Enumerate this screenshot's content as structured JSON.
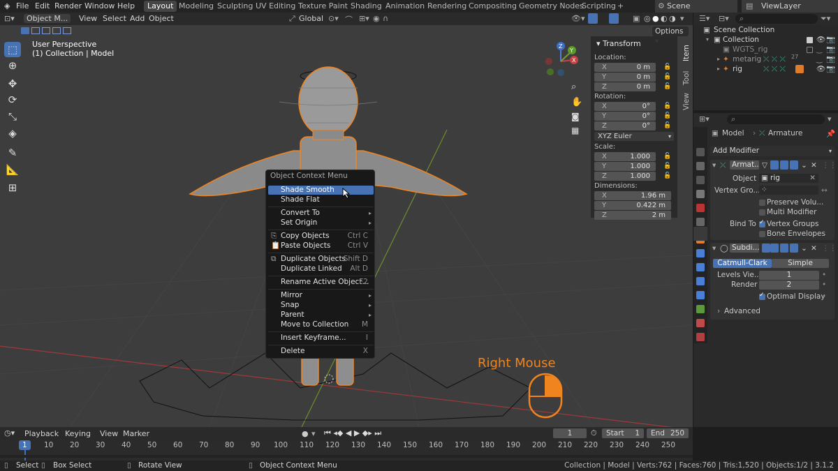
{
  "menubar": {
    "items": [
      "File",
      "Edit",
      "Render",
      "Window",
      "Help"
    ],
    "workspaces": [
      "Layout",
      "Modeling",
      "Sculpting",
      "UV Editing",
      "Texture Paint",
      "Shading",
      "Animation",
      "Rendering",
      "Compositing",
      "Geometry Nodes",
      "Scripting"
    ],
    "active_workspace": "Layout",
    "add_tab": "+",
    "scene": "Scene",
    "view_layer": "ViewLayer"
  },
  "viewport_header": {
    "mode": "Object M...",
    "menus": [
      "View",
      "Select",
      "Add",
      "Object"
    ],
    "orientation": "Global",
    "options_button": "Options"
  },
  "viewport": {
    "perspective": "User Perspective",
    "collection_info": "(1) Collection | Model",
    "hint_label": "Right Mouse",
    "gizmo_axes": [
      "X",
      "Y",
      "Z"
    ],
    "side_tabs": [
      "Item",
      "Tool",
      "View"
    ]
  },
  "transform_panel": {
    "title": "Transform",
    "location_label": "Location:",
    "location": [
      {
        "axis": "X",
        "value": "0 m"
      },
      {
        "axis": "Y",
        "value": "0 m"
      },
      {
        "axis": "Z",
        "value": "0 m"
      }
    ],
    "rotation_label": "Rotation:",
    "rotation": [
      {
        "axis": "X",
        "value": "0°"
      },
      {
        "axis": "Y",
        "value": "0°"
      },
      {
        "axis": "Z",
        "value": "0°"
      }
    ],
    "rotation_mode": "XYZ Euler",
    "scale_label": "Scale:",
    "scale": [
      {
        "axis": "X",
        "value": "1.000"
      },
      {
        "axis": "Y",
        "value": "1.000"
      },
      {
        "axis": "Z",
        "value": "1.000"
      }
    ],
    "dimensions_label": "Dimensions:",
    "dimensions": [
      {
        "axis": "X",
        "value": "1.96 m"
      },
      {
        "axis": "Y",
        "value": "0.422 m"
      },
      {
        "axis": "Z",
        "value": "2 m"
      }
    ]
  },
  "context_menu": {
    "title": "Object Context Menu",
    "items": [
      {
        "label": "Shade Smooth",
        "shortcut": ""
      },
      {
        "label": "Shade Flat",
        "shortcut": ""
      },
      {
        "label": "Convert To",
        "shortcut": ""
      },
      {
        "label": "Set Origin",
        "shortcut": ""
      },
      {
        "label": "Copy Objects",
        "shortcut": "Ctrl C"
      },
      {
        "label": "Paste Objects",
        "shortcut": "Ctrl V"
      },
      {
        "label": "Duplicate Objects",
        "shortcut": "Shift D"
      },
      {
        "label": "Duplicate Linked",
        "shortcut": "Alt D"
      },
      {
        "label": "Rename Active Object...",
        "shortcut": "F2"
      },
      {
        "label": "Mirror",
        "shortcut": ""
      },
      {
        "label": "Snap",
        "shortcut": ""
      },
      {
        "label": "Parent",
        "shortcut": ""
      },
      {
        "label": "Move to Collection",
        "shortcut": "M"
      },
      {
        "label": "Insert Keyframe...",
        "shortcut": "I"
      },
      {
        "label": "Delete",
        "shortcut": "X"
      }
    ]
  },
  "outliner": {
    "items": [
      {
        "label": "Scene Collection"
      },
      {
        "label": "Collection"
      },
      {
        "label": "WGTS_rig"
      },
      {
        "label": "metarig"
      },
      {
        "label": "rig"
      }
    ],
    "badge": "27"
  },
  "properties": {
    "breadcrumb": [
      "Model",
      "Armature"
    ],
    "add_modifier": "Add Modifier",
    "armature_mod": {
      "name": "Armat...",
      "object_label": "Object",
      "object_value": "rig",
      "vertex_group_label": "Vertex Gro...",
      "preserve_volume": "Preserve Volu...",
      "multi_modifier": "Multi Modifier",
      "bind_to_label": "Bind To",
      "vertex_groups": "Vertex Groups",
      "bone_envelopes": "Bone Envelopes"
    },
    "subdiv_mod": {
      "name": "Subdi...",
      "catmull": "Catmull-Clark",
      "simple": "Simple",
      "levels_label": "Levels Vie...",
      "levels_value": "1",
      "render_label": "Render",
      "render_value": "2",
      "optimal_display": "Optimal Display",
      "advanced": "Advanced"
    }
  },
  "timeline": {
    "menus": [
      "Playback",
      "Keying",
      "View",
      "Marker"
    ],
    "current_frame": "1",
    "start_label": "Start",
    "start_value": "1",
    "end_label": "End",
    "end_value": "250",
    "ticks": [
      "1",
      "10",
      "20",
      "30",
      "40",
      "50",
      "60",
      "70",
      "80",
      "90",
      "100",
      "110",
      "120",
      "130",
      "140",
      "150",
      "160",
      "170",
      "180",
      "190",
      "200",
      "210",
      "220",
      "230",
      "240",
      "250"
    ]
  },
  "statusbar": {
    "select": "Select",
    "box_select": "Box Select",
    "rotate_view": "Rotate View",
    "context_menu": "Object Context Menu",
    "stats": "Collection | Model | Verts:762 | Faces:760 | Tris:1,520 | Objects:1/2 | 3.1.2"
  },
  "colors": {
    "accent": "#4772b3",
    "selection_orange": "#f08520",
    "viewport_bg": "#3d3d3d"
  }
}
